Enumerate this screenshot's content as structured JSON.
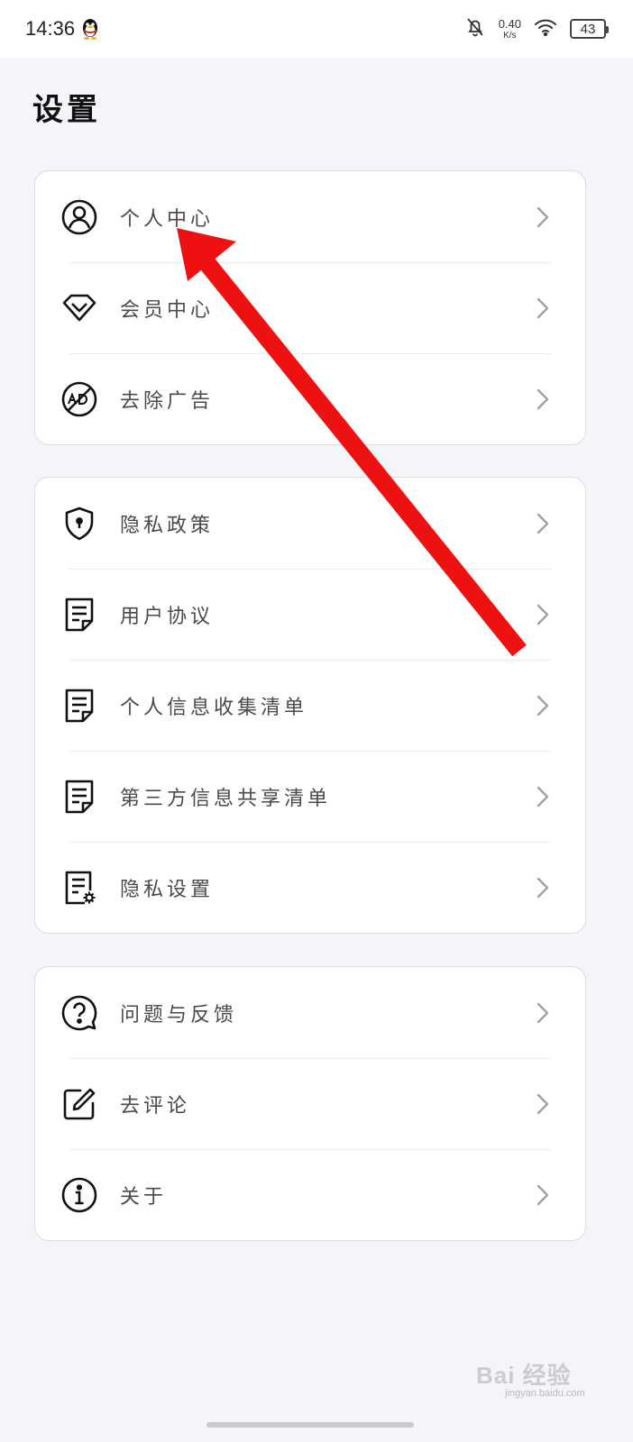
{
  "status_bar": {
    "time": "14:36",
    "net_speed_value": "0.40",
    "net_speed_unit": "K/s",
    "battery": "43"
  },
  "page_title": "设置",
  "groups": [
    {
      "items": [
        {
          "label": "个人中心",
          "icon": "user-circle-icon"
        },
        {
          "label": "会员中心",
          "icon": "diamond-vip-icon"
        },
        {
          "label": "去除广告",
          "icon": "no-ad-icon"
        }
      ]
    },
    {
      "items": [
        {
          "label": "隐私政策",
          "icon": "shield-lock-icon"
        },
        {
          "label": "用户协议",
          "icon": "document-icon"
        },
        {
          "label": "个人信息收集清单",
          "icon": "document-icon"
        },
        {
          "label": "第三方信息共享清单",
          "icon": "document-icon"
        },
        {
          "label": "隐私设置",
          "icon": "document-gear-icon"
        }
      ]
    },
    {
      "items": [
        {
          "label": "问题与反馈",
          "icon": "question-bubble-icon"
        },
        {
          "label": "去评论",
          "icon": "edit-icon"
        },
        {
          "label": "关于",
          "icon": "info-icon"
        }
      ]
    }
  ],
  "annotation": {
    "color": "#ee1111",
    "icon": "red-arrow-icon"
  },
  "watermark": {
    "text": "Bai 经验",
    "sub": "jingyan.baidu.com"
  }
}
